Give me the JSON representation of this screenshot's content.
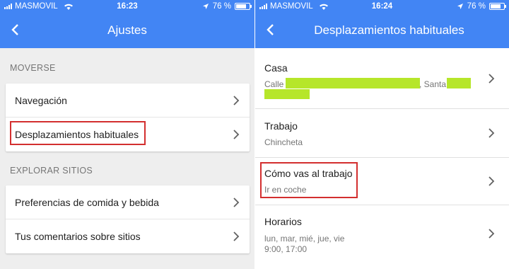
{
  "left": {
    "status": {
      "carrier": "MASMOVIL",
      "time": "16:23",
      "battery": "76 %"
    },
    "title": "Ajustes",
    "sections": [
      {
        "header": "MOVERSE",
        "items": [
          {
            "label": "Navegación"
          },
          {
            "label": "Desplazamientos habituales"
          }
        ]
      },
      {
        "header": "EXPLORAR SITIOS",
        "items": [
          {
            "label": "Preferencias de comida y bebida"
          },
          {
            "label": "Tus comentarios sobre sitios"
          }
        ]
      }
    ]
  },
  "right": {
    "status": {
      "carrier": "MASMOVIL",
      "time": "16:24",
      "battery": "76 %"
    },
    "title": "Desplazamientos habituales",
    "items": [
      {
        "title": "Casa",
        "subtitle_prefix": "Calle",
        "subtitle_mid": ", Santa"
      },
      {
        "title": "Trabajo",
        "subtitle": "Chincheta"
      },
      {
        "title": "Cómo vas al trabajo",
        "subtitle": "Ir en coche"
      },
      {
        "title": "Horarios",
        "subtitle_line1": "lun, mar, mié, jue, vie",
        "subtitle_line2": "9:00, 17:00"
      }
    ]
  },
  "colors": {
    "header": "#4285f4",
    "highlight": "#d32f2f",
    "redaction": "#b6e62a",
    "background": "#eeeeee"
  },
  "icons": {
    "back": "chevron-left-icon",
    "row": "chevron-right-icon",
    "location": "location-arrow-icon",
    "wifi": "wifi-icon",
    "battery": "battery-icon"
  }
}
